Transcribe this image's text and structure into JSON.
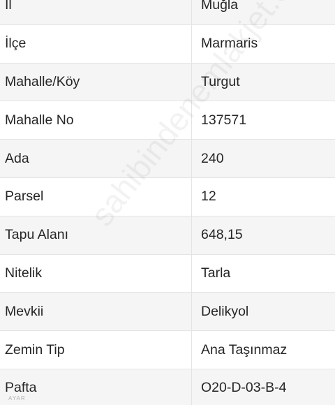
{
  "rows": [
    {
      "label": "İl",
      "value": "Muğla"
    },
    {
      "label": "İlçe",
      "value": "Marmaris"
    },
    {
      "label": "Mahalle/Köy",
      "value": "Turgut"
    },
    {
      "label": "Mahalle No",
      "value": "137571"
    },
    {
      "label": "Ada",
      "value": "240"
    },
    {
      "label": "Parsel",
      "value": "12"
    },
    {
      "label": "Tapu Alanı",
      "value": "648,15"
    },
    {
      "label": "Nitelik",
      "value": "Tarla"
    },
    {
      "label": "Mevkii",
      "value": "Delikyol"
    },
    {
      "label": "Zemin Tip",
      "value": "Ana Taşınmaz"
    },
    {
      "label": "Pafta",
      "value": "O20-D-03-B-4"
    }
  ],
  "watermark": "sahibindenemlakjet.com",
  "watermark_small": "AYAR"
}
